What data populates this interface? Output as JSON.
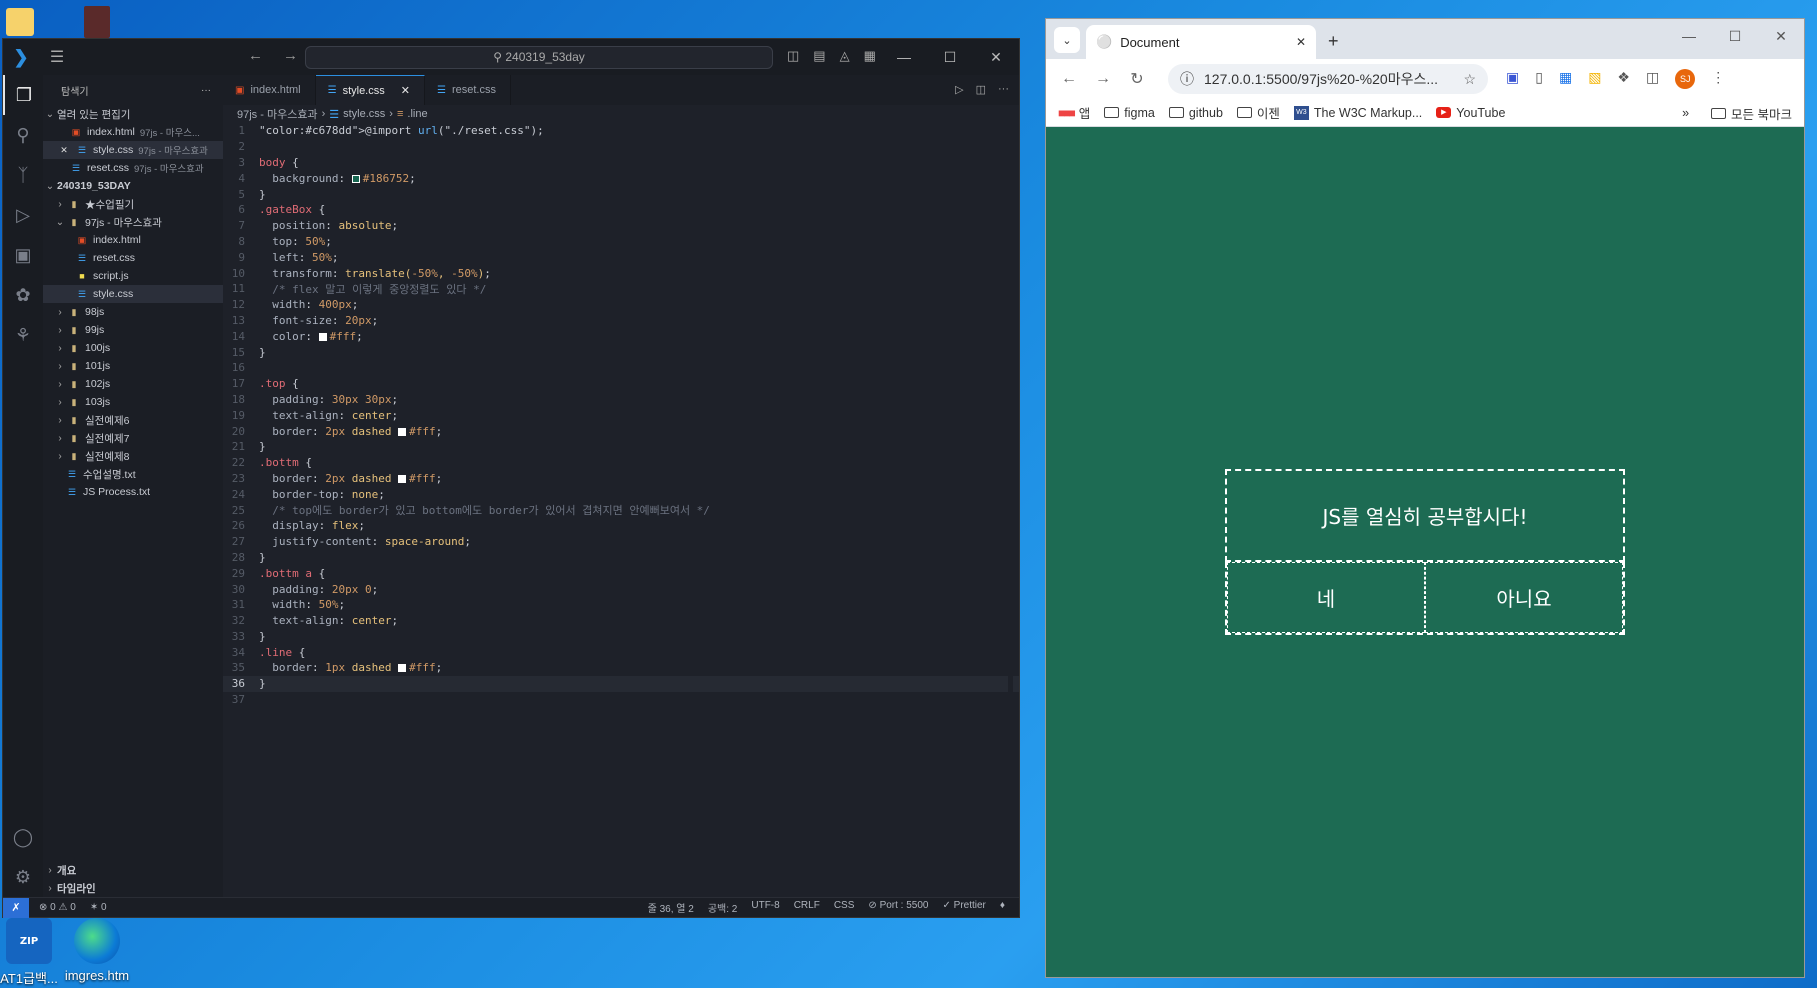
{
  "desktop": {
    "icons": [
      {
        "label": "AT1급백..."
      },
      {
        "label": "imgres.htm"
      }
    ]
  },
  "vscode": {
    "title": "240319_53day",
    "explorer_label": "탐색기",
    "open_editors_label": "열려 있는 편집기",
    "open_editors": [
      {
        "name": "index.html",
        "desc": "97js - 마우스..."
      },
      {
        "name": "style.css",
        "desc": "97js - 마우스효과"
      },
      {
        "name": "reset.css",
        "desc": "97js - 마우스효과"
      }
    ],
    "workspace_label": "240319_53DAY",
    "tree": [
      {
        "name": "★수업필기",
        "type": "folder",
        "depth": 1,
        "open": false
      },
      {
        "name": "97js - 마우스효과",
        "type": "folder",
        "depth": 1,
        "open": true
      },
      {
        "name": "index.html",
        "type": "html",
        "depth": 2
      },
      {
        "name": "reset.css",
        "type": "css",
        "depth": 2
      },
      {
        "name": "script.js",
        "type": "js",
        "depth": 2
      },
      {
        "name": "style.css",
        "type": "css",
        "depth": 2,
        "selected": true
      },
      {
        "name": "98js",
        "type": "folder",
        "depth": 1,
        "open": false
      },
      {
        "name": "99js",
        "type": "folder",
        "depth": 1,
        "open": false
      },
      {
        "name": "100js",
        "type": "folder",
        "depth": 1,
        "open": false
      },
      {
        "name": "101js",
        "type": "folder",
        "depth": 1,
        "open": false
      },
      {
        "name": "102js",
        "type": "folder",
        "depth": 1,
        "open": false
      },
      {
        "name": "103js",
        "type": "folder",
        "depth": 1,
        "open": false
      },
      {
        "name": "실전예제6",
        "type": "folder",
        "depth": 1,
        "open": false
      },
      {
        "name": "실전예제7",
        "type": "folder",
        "depth": 1,
        "open": false
      },
      {
        "name": "실전예제8",
        "type": "folder",
        "depth": 1,
        "open": false
      },
      {
        "name": "수업설명.txt",
        "type": "txt",
        "depth": 1
      },
      {
        "name": "JS Process.txt",
        "type": "txt",
        "depth": 1
      }
    ],
    "outline_label": "개요",
    "timeline_label": "타임라인",
    "tabs": [
      {
        "label": "index.html",
        "icon": "html-icon",
        "active": false
      },
      {
        "label": "style.css",
        "icon": "css-icon",
        "active": true
      },
      {
        "label": "reset.css",
        "icon": "css-icon",
        "active": false
      }
    ],
    "breadcrumb": [
      "97js - 마우스효과",
      "style.css",
      ".line"
    ],
    "code_lines": [
      "@import url(\"./reset.css\");",
      "",
      "body {",
      "  background: #186752;",
      "}",
      ".gateBox {",
      "  position: absolute;",
      "  top: 50%;",
      "  left: 50%;",
      "  transform: translate(-50%, -50%);",
      "  /* flex 말고 이렇게 중앙정렬도 있다 */",
      "  width: 400px;",
      "  font-size: 20px;",
      "  color: #fff;",
      "}",
      "",
      ".top {",
      "  padding: 30px 30px;",
      "  text-align: center;",
      "  border: 2px dashed #fff;",
      "}",
      ".bottm {",
      "  border: 2px dashed #fff;",
      "  border-top: none;",
      "  /* top에도 border가 있고 bottom에도 border가 있어서 겹쳐지면 안예뻐보여서 */",
      "  display: flex;",
      "  justify-content: space-around;",
      "}",
      ".bottm a {",
      "  padding: 20px 0;",
      "  width: 50%;",
      "  text-align: center;",
      "}",
      ".line {",
      "  border: 1px dashed #fff;",
      "}",
      ""
    ],
    "current_line": 36,
    "status": {
      "errors": "0",
      "warnings": "0",
      "ports": "0",
      "cursor": "줄 36, 열 2",
      "spaces": "공백: 2",
      "encoding": "UTF-8",
      "eol": "CRLF",
      "language": "CSS",
      "port": "Port : 5500",
      "prettier": "Prettier"
    },
    "colors": {
      "accent": "#2c8fe0",
      "bg": "#1e2129"
    }
  },
  "chrome": {
    "tab_title": "Document",
    "url": "127.0.0.1:5500/97js%20-%20마우스...",
    "profile_initials": "SJ",
    "bookmarks": [
      {
        "label": "앱",
        "icon": "apps-icon"
      },
      {
        "label": "figma",
        "icon": "folder-icon"
      },
      {
        "label": "github",
        "icon": "folder-icon"
      },
      {
        "label": "이젠",
        "icon": "folder-icon"
      },
      {
        "label": "The W3C Markup...",
        "icon": "w3c-icon"
      },
      {
        "label": "YouTube",
        "icon": "youtube-icon"
      }
    ],
    "more_bookmarks": "»",
    "all_bookmarks": "모든 북마크",
    "page": {
      "background": "#1d6b53",
      "top_text": "JS를 열심히 공부합시다!",
      "yes_label": "네",
      "no_label": "아니요"
    }
  }
}
